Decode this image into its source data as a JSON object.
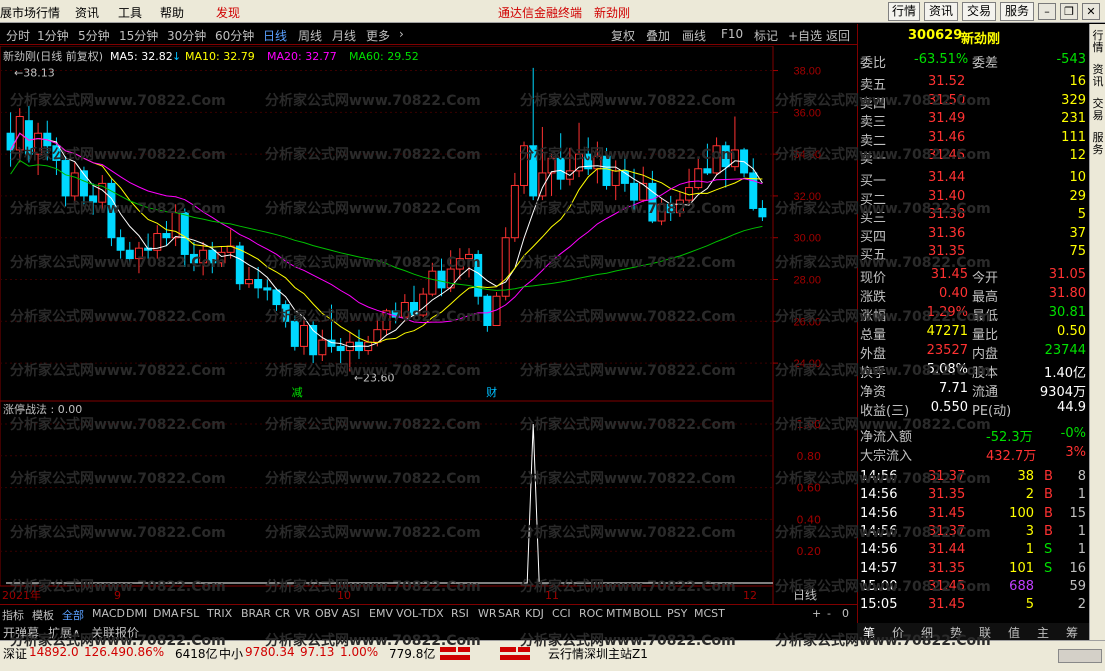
{
  "menu": {
    "items": [
      "展市场行情",
      "资讯",
      "工具",
      "帮助",
      "发现"
    ],
    "center_title": "通达信金融终端",
    "center_stock": "新劲刚",
    "right_btns": [
      "行情",
      "资讯",
      "交易",
      "服务"
    ]
  },
  "period": {
    "items": [
      "分时",
      "1分钟",
      "5分钟",
      "15分钟",
      "30分钟",
      "60分钟",
      "日线",
      "周线",
      "月线",
      "更多",
      "›"
    ],
    "active": "日线",
    "right": [
      "复权",
      "叠加",
      "画线",
      "F10",
      "标记",
      "+自选",
      "返回"
    ]
  },
  "ma": {
    "title": "新劲刚(日线 前复权)",
    "ma5": "MA5: 32.82",
    "ma10": "MA10: 32.79",
    "ma20": "MA20: 32.77",
    "ma60": "MA60: 29.52"
  },
  "chart_data": {
    "type": "candlestick",
    "yticks": [
      "38.00",
      "36.00",
      "34.00",
      "32.00",
      "30.00",
      "28.00",
      "26.00",
      "24.00"
    ],
    "ylim": [
      23.0,
      38.6
    ],
    "high_label": "38.13",
    "low_label": "23.60",
    "markers": [
      "减",
      "财"
    ],
    "x_labels": [
      "2021年",
      "9",
      "10",
      "11",
      "12"
    ],
    "candles": [
      [
        35.0,
        34.2,
        36.0,
        33.4
      ],
      [
        34.2,
        35.8,
        36.2,
        33.6
      ],
      [
        35.6,
        34.0,
        36.3,
        33.6
      ],
      [
        34.0,
        35.0,
        35.5,
        33.0
      ],
      [
        35.0,
        34.4,
        35.6,
        33.7
      ],
      [
        34.4,
        33.7,
        34.8,
        33.0
      ],
      [
        33.7,
        32.0,
        33.9,
        31.5
      ],
      [
        32.0,
        33.1,
        33.6,
        31.6
      ],
      [
        33.2,
        32.0,
        33.4,
        31.6
      ],
      [
        32.0,
        31.7,
        32.6,
        31.1
      ],
      [
        31.7,
        32.6,
        33.0,
        31.2
      ],
      [
        32.6,
        30.0,
        32.8,
        29.6
      ],
      [
        30.0,
        29.4,
        30.4,
        29.0
      ],
      [
        29.4,
        29.0,
        29.8,
        28.7
      ],
      [
        29.0,
        29.5,
        29.8,
        28.3
      ],
      [
        29.5,
        29.4,
        30.2,
        29.0
      ],
      [
        29.4,
        30.2,
        30.6,
        29.0
      ],
      [
        30.2,
        30.0,
        30.8,
        29.6
      ],
      [
        30.0,
        31.2,
        31.6,
        29.6
      ],
      [
        31.2,
        29.2,
        31.4,
        28.6
      ],
      [
        29.2,
        28.8,
        29.8,
        28.4
      ],
      [
        28.8,
        29.4,
        29.8,
        28.2
      ],
      [
        29.4,
        28.8,
        29.8,
        28.3
      ],
      [
        28.8,
        29.3,
        29.6,
        28.6
      ],
      [
        29.3,
        29.6,
        30.4,
        29.0
      ],
      [
        29.6,
        27.8,
        29.8,
        27.5
      ],
      [
        27.8,
        28.0,
        28.6,
        27.6
      ],
      [
        28.0,
        27.6,
        28.6,
        27.1
      ],
      [
        27.6,
        27.5,
        28.0,
        27.0
      ],
      [
        27.5,
        26.8,
        27.6,
        26.5
      ],
      [
        26.8,
        26.0,
        27.0,
        25.7
      ],
      [
        26.0,
        24.8,
        26.3,
        24.6
      ],
      [
        24.8,
        25.8,
        26.2,
        24.4
      ],
      [
        25.8,
        24.4,
        26.0,
        24.0
      ],
      [
        24.4,
        25.1,
        25.6,
        24.1
      ],
      [
        25.1,
        24.8,
        26.8,
        24.5
      ],
      [
        24.8,
        24.6,
        25.2,
        24.0
      ],
      [
        24.6,
        25.0,
        25.5,
        23.6
      ],
      [
        25.0,
        24.6,
        25.6,
        24.2
      ],
      [
        24.6,
        25.0,
        25.3,
        24.4
      ],
      [
        25.0,
        25.6,
        26.2,
        24.8
      ],
      [
        25.6,
        26.5,
        26.6,
        25.3
      ],
      [
        26.5,
        26.2,
        26.9,
        25.9
      ],
      [
        26.2,
        26.9,
        27.3,
        26.0
      ],
      [
        26.9,
        26.3,
        27.7,
        26.1
      ],
      [
        26.3,
        27.3,
        27.6,
        26.2
      ],
      [
        27.3,
        28.4,
        28.8,
        27.2
      ],
      [
        28.4,
        27.6,
        29.0,
        27.2
      ],
      [
        27.6,
        28.5,
        29.4,
        27.4
      ],
      [
        28.5,
        29.0,
        29.5,
        28.0
      ],
      [
        29.0,
        29.2,
        29.5,
        28.1
      ],
      [
        29.2,
        27.2,
        29.4,
        26.8
      ],
      [
        27.2,
        25.8,
        27.3,
        25.5
      ],
      [
        25.8,
        27.2,
        27.4,
        25.8
      ],
      [
        27.2,
        30.0,
        30.5,
        27.0
      ],
      [
        30.0,
        32.5,
        33.1,
        29.8
      ],
      [
        32.5,
        34.4,
        34.6,
        32.1
      ],
      [
        34.4,
        32.0,
        38.13,
        31.8
      ],
      [
        32.0,
        33.1,
        35.3,
        31.8
      ],
      [
        33.1,
        33.8,
        34.0,
        32.0
      ],
      [
        33.8,
        32.8,
        35.0,
        32.3
      ],
      [
        32.8,
        33.2,
        34.3,
        32.5
      ],
      [
        33.2,
        34.0,
        35.5,
        32.9
      ],
      [
        34.0,
        33.3,
        34.8,
        33.0
      ],
      [
        33.3,
        33.9,
        34.6,
        32.6
      ],
      [
        33.9,
        32.5,
        34.3,
        32.3
      ],
      [
        32.5,
        33.2,
        33.7,
        31.8
      ],
      [
        33.2,
        32.6,
        33.9,
        32.2
      ],
      [
        32.6,
        31.8,
        33.3,
        31.2
      ],
      [
        31.8,
        32.6,
        33.4,
        31.7
      ],
      [
        32.6,
        30.8,
        33.2,
        30.7
      ],
      [
        30.8,
        31.6,
        31.9,
        30.6
      ],
      [
        31.6,
        31.2,
        32.0,
        30.8
      ],
      [
        31.2,
        31.8,
        32.2,
        31.0
      ],
      [
        31.8,
        32.4,
        33.3,
        31.6
      ],
      [
        32.4,
        33.3,
        33.8,
        32.3
      ],
      [
        33.3,
        33.1,
        34.5,
        33.0
      ],
      [
        33.1,
        34.4,
        34.8,
        33.0
      ],
      [
        34.4,
        33.4,
        34.6,
        32.4
      ],
      [
        33.4,
        34.2,
        35.8,
        33.2
      ],
      [
        34.2,
        33.1,
        34.3,
        32.9
      ],
      [
        33.1,
        31.4,
        33.8,
        31.3
      ],
      [
        31.4,
        31.0,
        31.8,
        30.8
      ]
    ],
    "ma_values": {
      "MA5": [
        32.82
      ],
      "MA10": [
        32.79
      ],
      "MA20": [
        32.77
      ],
      "MA60": [
        29.52
      ]
    },
    "indicator": {
      "name": "涨停战法",
      "value": "0.00",
      "yticks": [
        "1.00",
        "0.80",
        "0.60",
        "0.40",
        "0.20"
      ],
      "spike_index": 57,
      "spike_value": 1.0
    },
    "colors": {
      "up": "#ff3232",
      "down": "#00d8ff",
      "ma5": "#ffffff",
      "ma10": "#ffff00",
      "ma20": "#ff00ff",
      "ma60": "#00c000"
    }
  },
  "indicators_bar": {
    "items": [
      "指标",
      "模板",
      "全部",
      "MACD",
      "DMI",
      "DMA",
      "FSL",
      "TRIX",
      "BRAR",
      "CR",
      "VR",
      "OBV",
      "ASI",
      "EMV",
      "VOL-TDX",
      "RSI",
      "WR",
      "SAR",
      "KDJ",
      "CCI",
      "ROC",
      "MTM",
      "BOLL",
      "PSY",
      "MCST"
    ],
    "active": "全部",
    "day": "日线",
    "ctrls": [
      "+",
      "-",
      "0"
    ]
  },
  "bar2": {
    "items": [
      "开弹幕",
      "扩展∧",
      "关联报价"
    ]
  },
  "quote": {
    "code": "300629",
    "name": "新劲刚",
    "wb_label": "委比",
    "wb_val": "-63.51%",
    "wc_label": "委差",
    "wc_val": "-543",
    "sells": [
      {
        "l": "卖五",
        "p": "31.52",
        "v": "16"
      },
      {
        "l": "卖四",
        "p": "31.50",
        "v": "329"
      },
      {
        "l": "卖三",
        "p": "31.49",
        "v": "231"
      },
      {
        "l": "卖二",
        "p": "31.46",
        "v": "111"
      },
      {
        "l": "卖一",
        "p": "31.45",
        "v": "12"
      }
    ],
    "buys": [
      {
        "l": "买一",
        "p": "31.44",
        "v": "10"
      },
      {
        "l": "买二",
        "p": "31.40",
        "v": "29"
      },
      {
        "l": "买三",
        "p": "31.38",
        "v": "5"
      },
      {
        "l": "买四",
        "p": "31.36",
        "v": "37"
      },
      {
        "l": "买五",
        "p": "31.35",
        "v": "75"
      }
    ],
    "stats": [
      {
        "l1": "现价",
        "v1": "31.45",
        "l2": "今开",
        "v2": "31.05",
        "c1": "#ff3232",
        "c2": "#ff3232"
      },
      {
        "l1": "涨跌",
        "v1": "0.40",
        "l2": "最高",
        "v2": "31.80",
        "c1": "#ff3232",
        "c2": "#ff3232"
      },
      {
        "l1": "涨幅",
        "v1": "1.29%",
        "l2": "最低",
        "v2": "30.81",
        "c1": "#ff3232",
        "c2": "#00e000"
      },
      {
        "l1": "总量",
        "v1": "47271",
        "l2": "量比",
        "v2": "0.50",
        "c1": "#ffff00",
        "c2": "#ffff00"
      },
      {
        "l1": "外盘",
        "v1": "23527",
        "l2": "内盘",
        "v2": "23744",
        "c1": "#ff3232",
        "c2": "#00e000"
      },
      {
        "l1": "换手",
        "v1": "5.08%",
        "l2": "股本",
        "v2": "1.40亿",
        "c1": "#ffffff",
        "c2": "#ffffff"
      },
      {
        "l1": "净资",
        "v1": "7.71",
        "l2": "流通",
        "v2": "9304万",
        "c1": "#ffffff",
        "c2": "#ffffff"
      },
      {
        "l1": "收益(三)",
        "v1": "0.550",
        "l2": "PE(动)",
        "v2": "44.9",
        "c1": "#ffffff",
        "c2": "#ffffff"
      }
    ],
    "flow": [
      {
        "l": "净流入额",
        "v": "-52.3万",
        "p": "-0%",
        "c": "#00e000"
      },
      {
        "l": "大宗流入",
        "v": "432.7万",
        "p": "3%",
        "c": "#ff3232"
      }
    ],
    "ticks": [
      {
        "t": "14:56",
        "p": "31.37",
        "v": "38",
        "d": "B",
        "n": "8"
      },
      {
        "t": "14:56",
        "p": "31.35",
        "v": "2",
        "d": "B",
        "n": "1"
      },
      {
        "t": "14:56",
        "p": "31.45",
        "v": "100",
        "d": "B",
        "n": "15"
      },
      {
        "t": "14:56",
        "p": "31.37",
        "v": "3",
        "d": "B",
        "n": "1"
      },
      {
        "t": "14:56",
        "p": "31.44",
        "v": "1",
        "d": "S",
        "n": "1"
      },
      {
        "t": "14:57",
        "p": "31.35",
        "v": "101",
        "d": "S",
        "n": "16"
      },
      {
        "t": "15:00",
        "p": "31.45",
        "v": "688",
        "d": "",
        "n": "59"
      },
      {
        "t": "15:05",
        "p": "31.45",
        "v": "5",
        "d": "",
        "n": "2"
      }
    ],
    "tabs": [
      "笔",
      "价",
      "细",
      "势",
      "联",
      "值",
      "主",
      "筹"
    ]
  },
  "vtabs": [
    "行情",
    "资讯",
    "交易",
    "服务"
  ],
  "status": {
    "sz_label": "深证",
    "sz_val": "14892.0",
    "sz_chg": "126.49",
    "sz_pct": "0.86%",
    "sz_amt": "6418亿",
    "zx_label": "中小",
    "zx_val": "9780.34",
    "zx_chg": "97.13",
    "zx_pct": "1.00%",
    "zx_amt": "779.8亿",
    "server": "云行情深圳主站Z1"
  },
  "watermark": "分析家公式网www.70822.Com"
}
